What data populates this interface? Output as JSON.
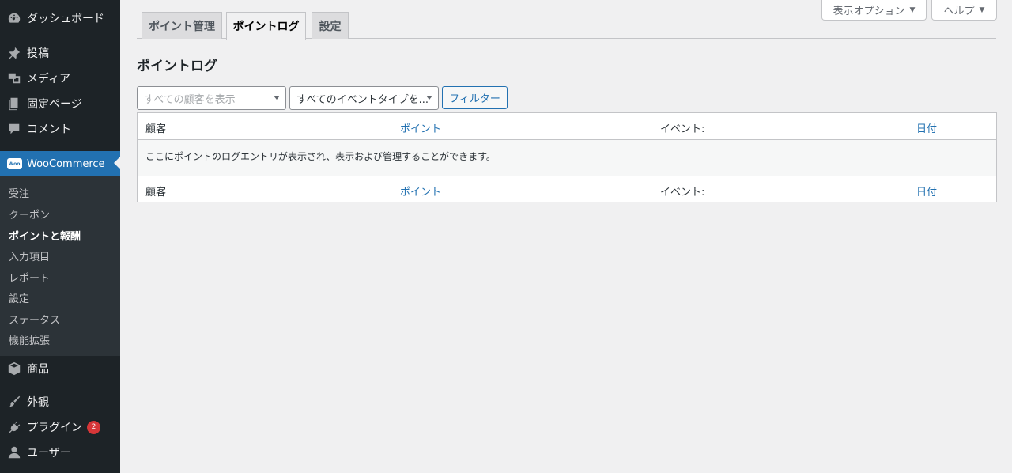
{
  "sidebar": {
    "items": [
      {
        "label": "ダッシュボード",
        "icon": "dashboard-icon"
      },
      {
        "label": "投稿",
        "icon": "pin-icon"
      },
      {
        "label": "メディア",
        "icon": "media-icon"
      },
      {
        "label": "固定ページ",
        "icon": "page-icon"
      },
      {
        "label": "コメント",
        "icon": "comment-icon"
      },
      {
        "label": "WooCommerce",
        "icon": "woo-icon"
      },
      {
        "label": "商品",
        "icon": "box-icon"
      },
      {
        "label": "外観",
        "icon": "brush-icon"
      },
      {
        "label": "プラグイン",
        "icon": "plugin-icon",
        "badge": "2"
      },
      {
        "label": "ユーザー",
        "icon": "user-icon"
      }
    ],
    "submenu": [
      {
        "label": "受注"
      },
      {
        "label": "クーポン"
      },
      {
        "label": "ポイントと報酬"
      },
      {
        "label": "入力項目"
      },
      {
        "label": "レポート"
      },
      {
        "label": "設定"
      },
      {
        "label": "ステータス"
      },
      {
        "label": "機能拡張"
      }
    ]
  },
  "screen_meta": {
    "options_label": "表示オプション",
    "help_label": "ヘルプ"
  },
  "tabs": [
    {
      "label": "ポイント管理"
    },
    {
      "label": "ポイントログ"
    },
    {
      "label": "設定"
    }
  ],
  "page_title": "ポイントログ",
  "filters": {
    "customer_placeholder": "すべての顧客を表示",
    "event_type_value": "すべてのイベントタイプを...",
    "filter_button": "フィルター"
  },
  "table": {
    "columns": [
      "顧客",
      "ポイント",
      "イベント:",
      "日付"
    ],
    "empty_message": "ここにポイントのログエントリが表示され、表示および管理することができます。"
  },
  "colors": {
    "sidebar_bg": "#1d2327",
    "accent": "#2271b1",
    "badge": "#d63638"
  }
}
